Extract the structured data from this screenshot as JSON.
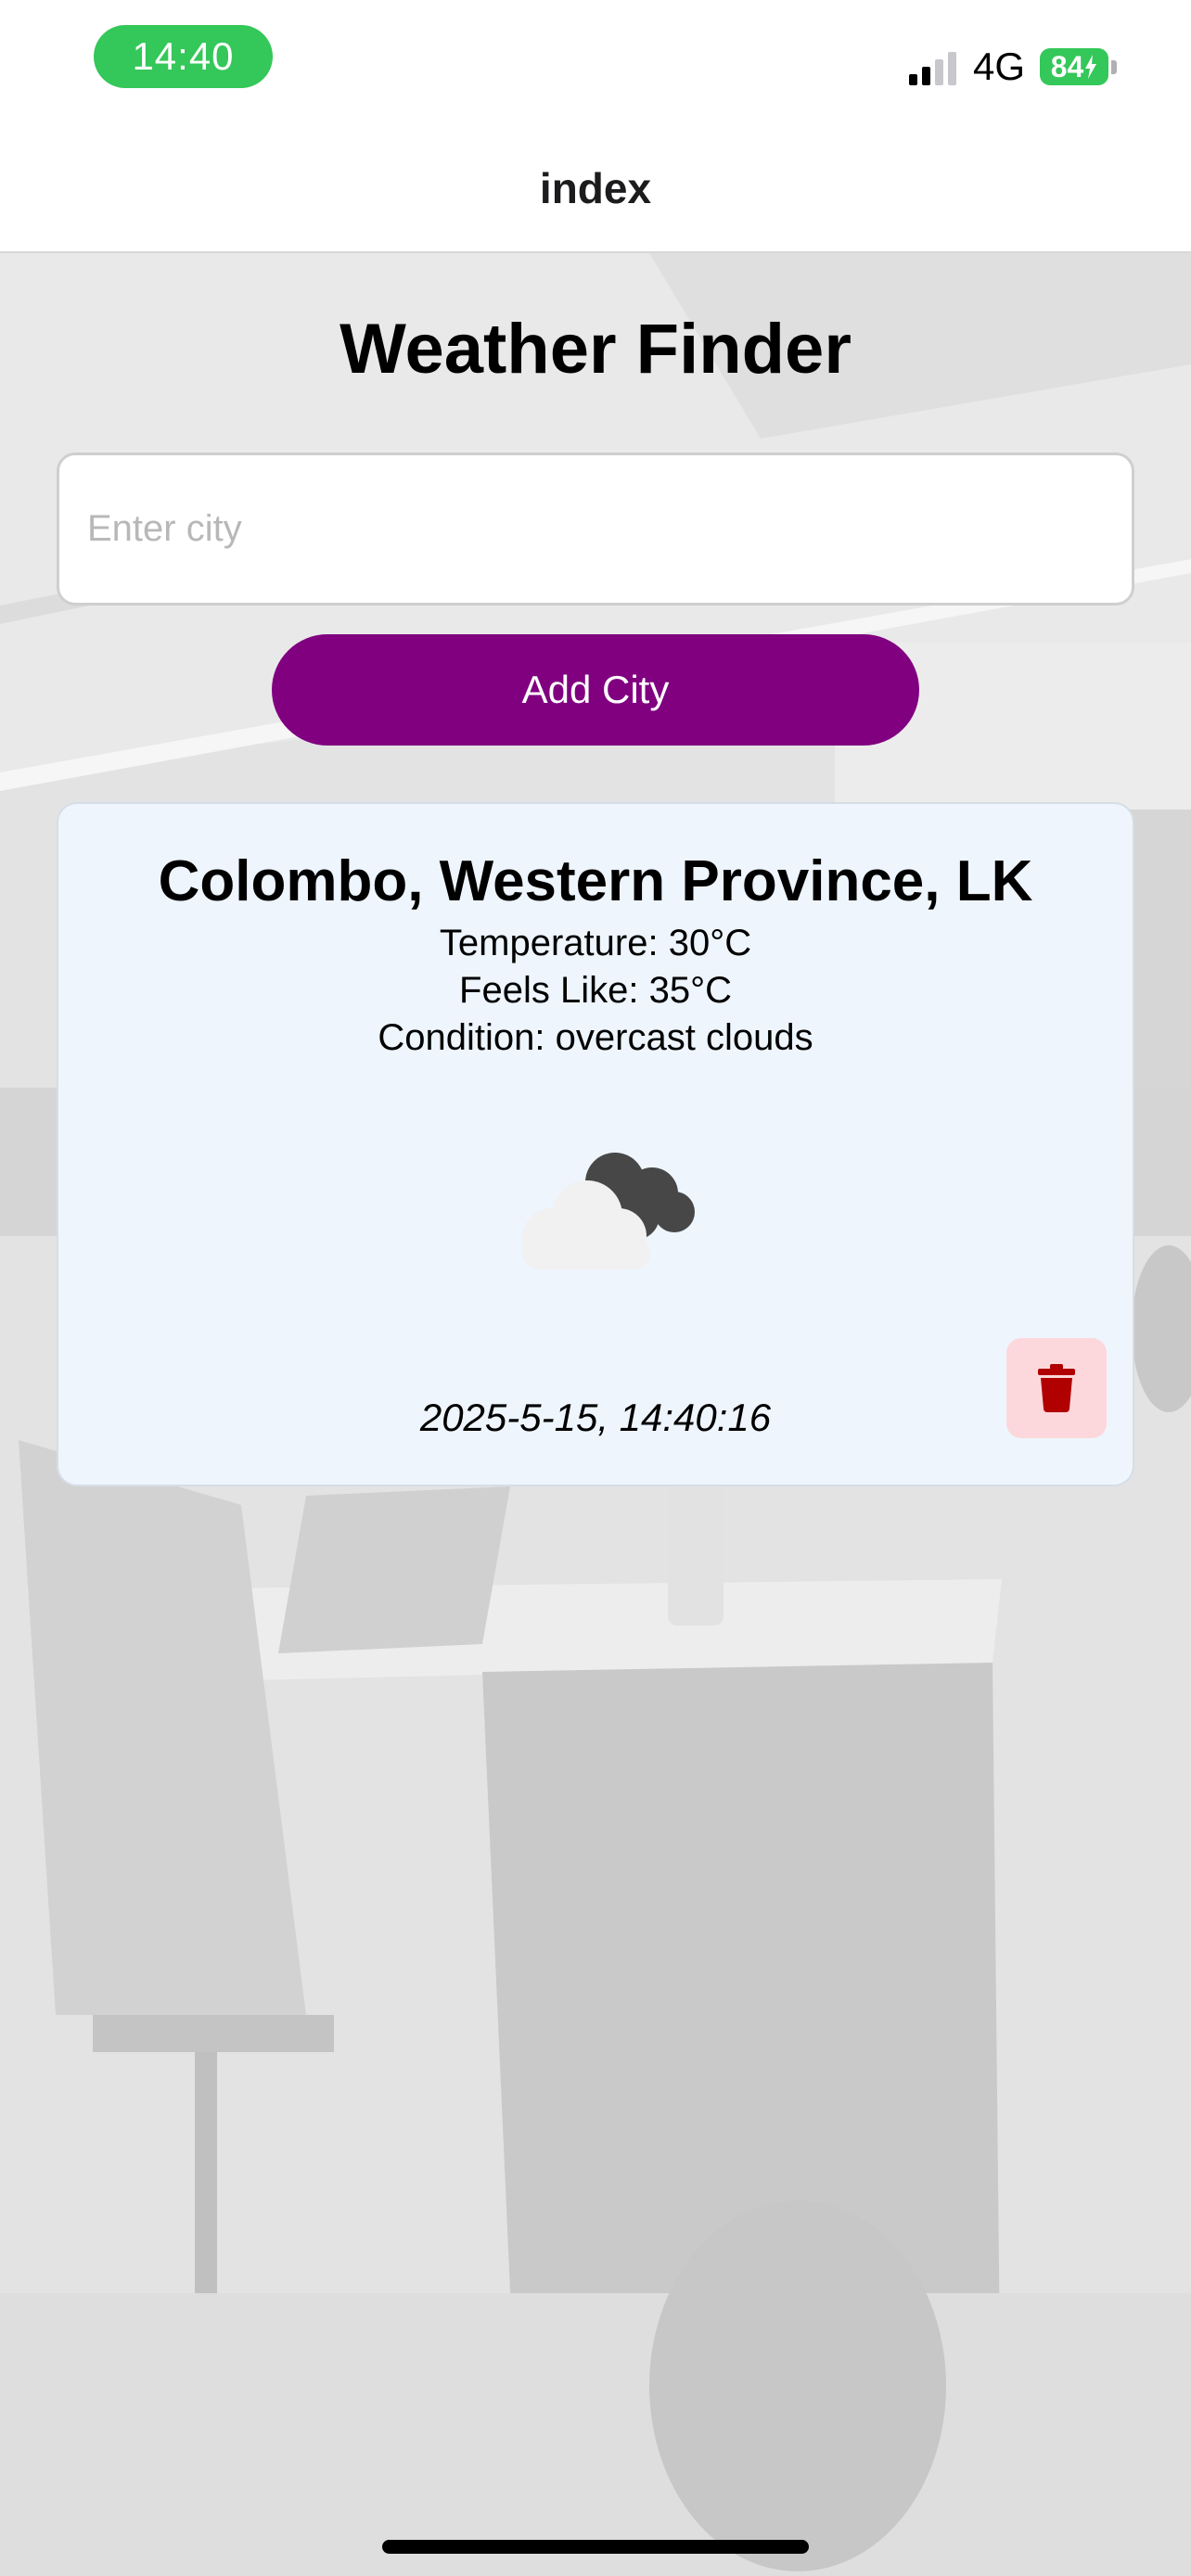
{
  "status_bar": {
    "time": "14:40",
    "network": "4G",
    "battery": "84"
  },
  "nav": {
    "title": "index"
  },
  "app": {
    "title": "Weather Finder"
  },
  "search": {
    "placeholder": "Enter city",
    "value": ""
  },
  "add_button": {
    "label": "Add City"
  },
  "weather_card": {
    "city": "Colombo, Western Province, LK",
    "temperature": "Temperature: 30°C",
    "feels_like": "Feels Like: 35°C",
    "condition": "Condition: overcast clouds",
    "icon": "overcast-clouds-icon",
    "timestamp": "2025-5-15, 14:40:16"
  },
  "colors": {
    "accent_purple": "#800080",
    "status_green": "#34c759",
    "card_background": "#eef5fd",
    "delete_red": "#b00000",
    "delete_background": "#fcd8dc"
  }
}
